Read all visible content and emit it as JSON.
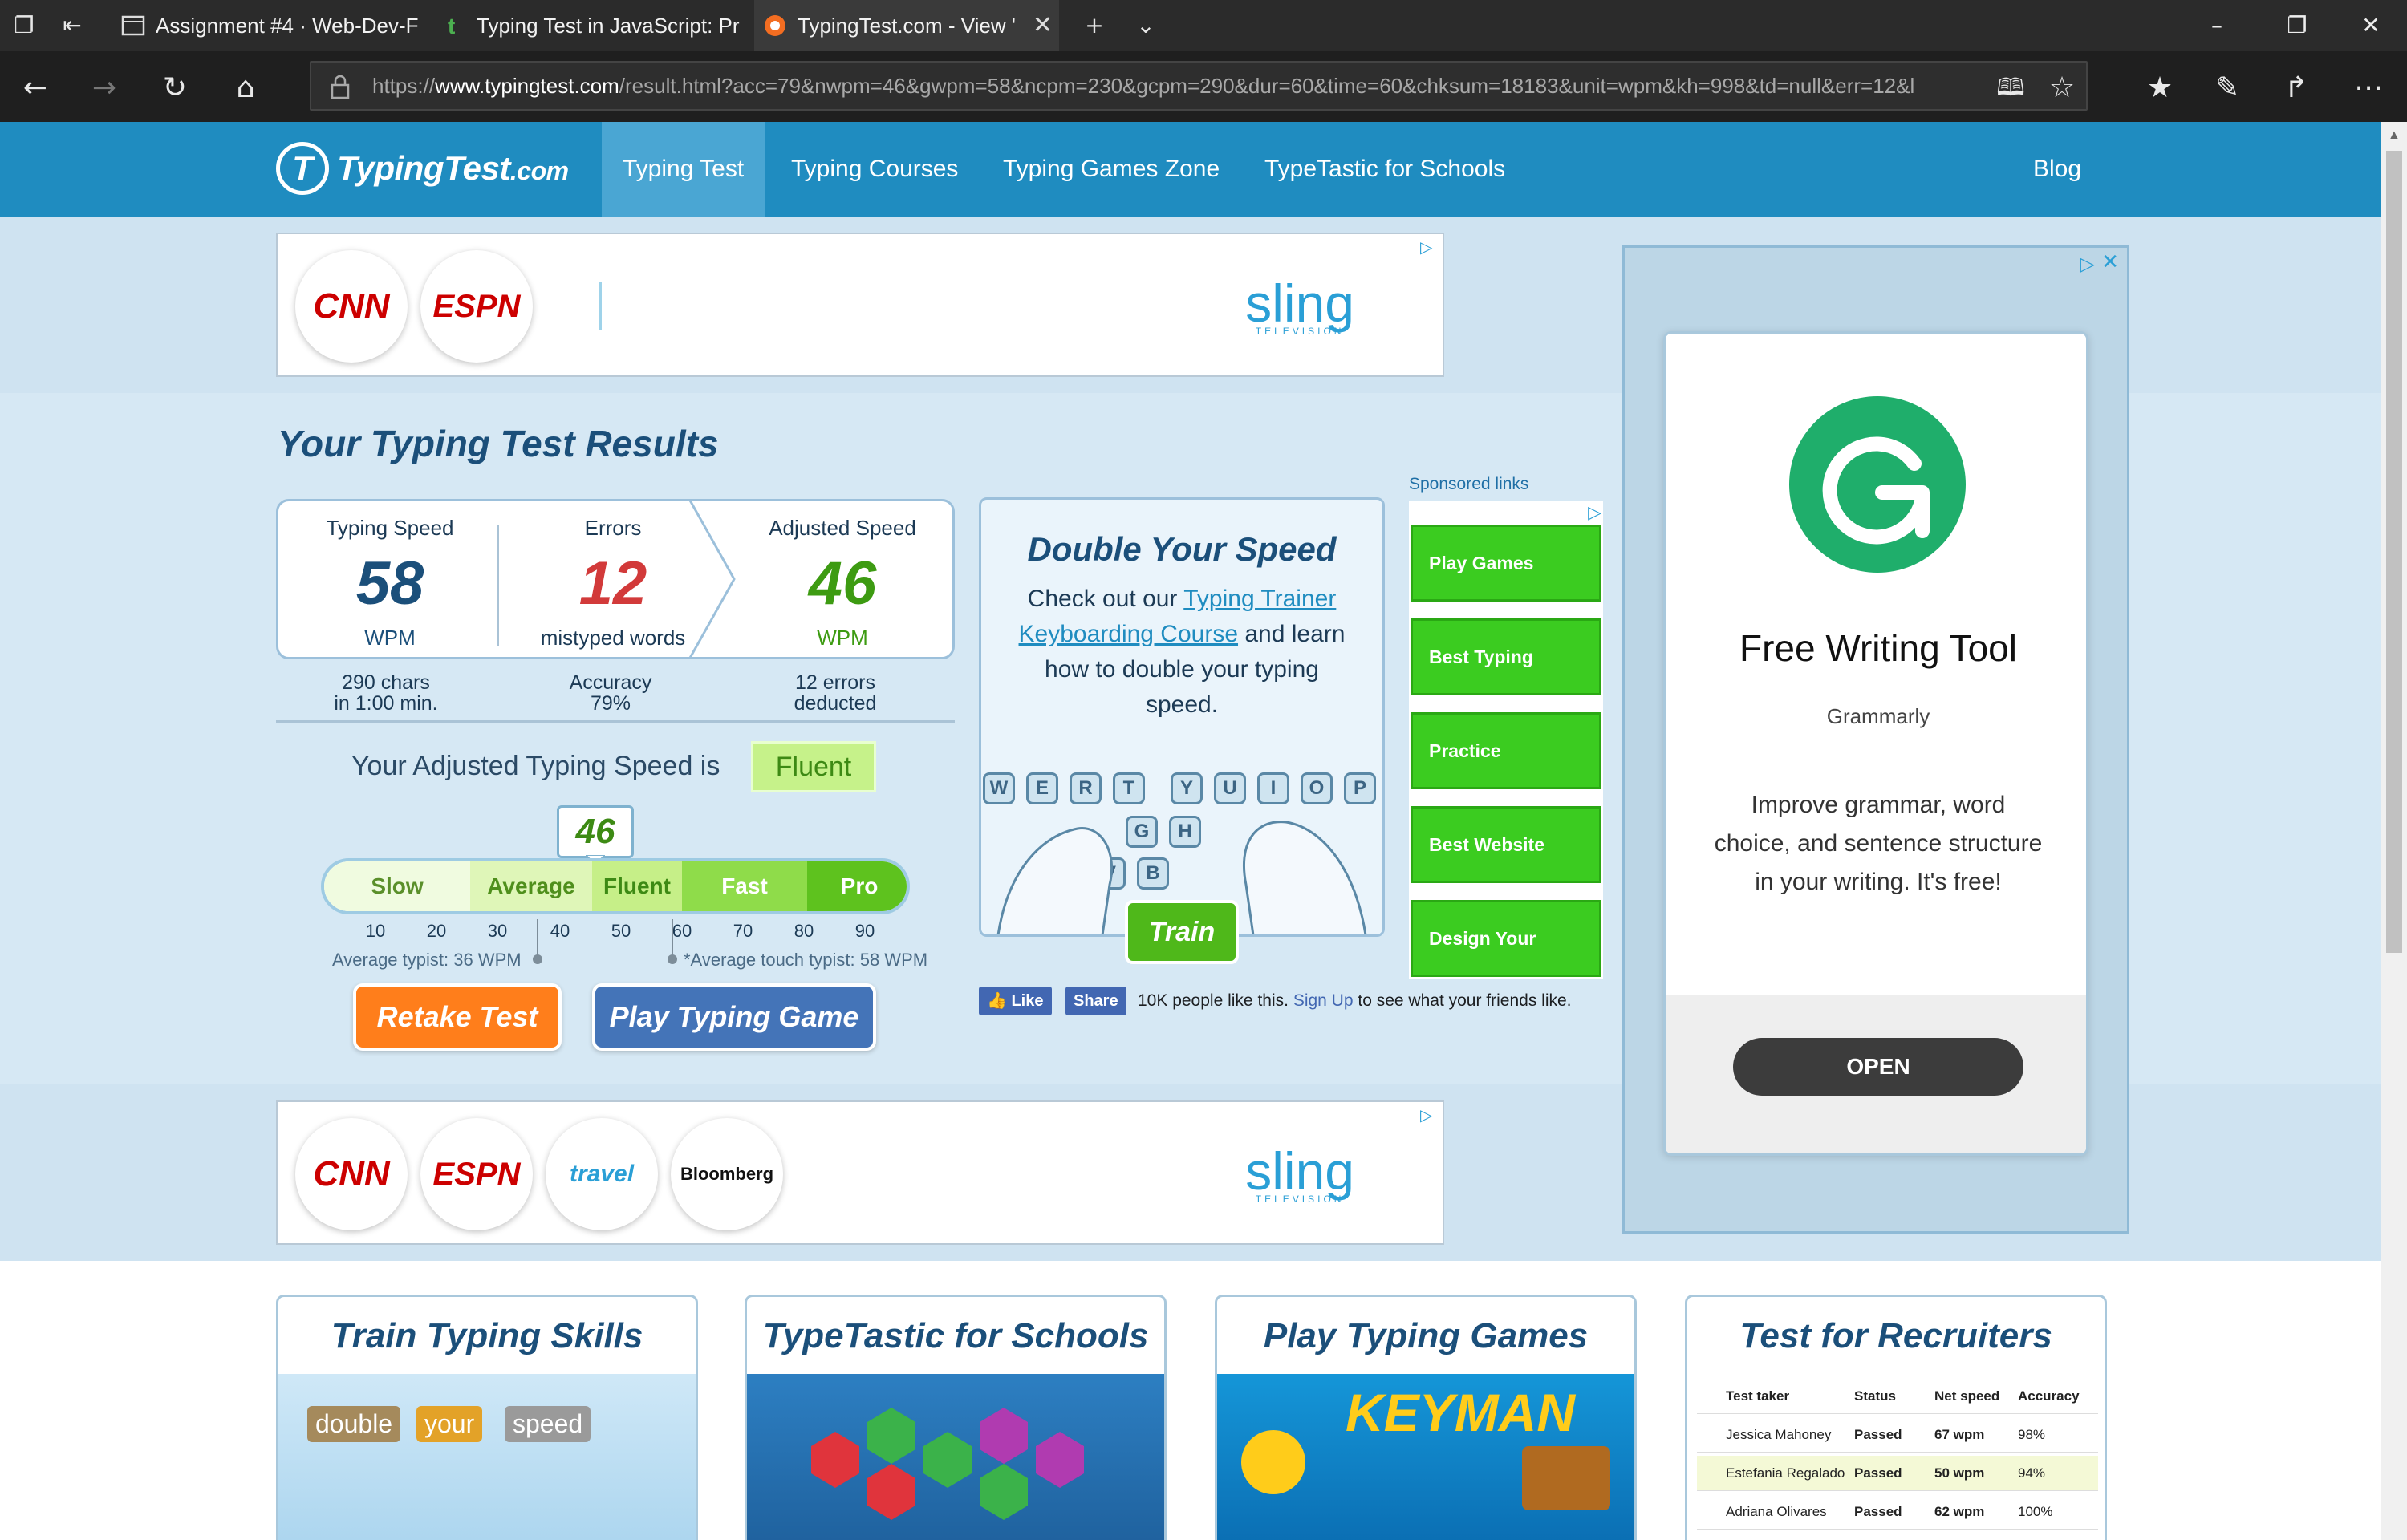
{
  "browser": {
    "tabs": [
      {
        "title": "Assignment #4 · Web-Dev-F"
      },
      {
        "title": "Typing Test in JavaScript: Pr"
      },
      {
        "title": "TypingTest.com - View '"
      }
    ],
    "url_prefix": "https://",
    "url_host": "www.typingtest.com",
    "url_rest": "/result.html?acc=79&nwpm=46&gwpm=58&ncpm=230&gcpm=290&dur=60&time=60&chksum=18183&unit=wpm&kh=998&td=null&err=12&l"
  },
  "site": {
    "logo_main": "TypingTest",
    "logo_tld": ".com",
    "nav": [
      "Typing Test",
      "Typing Courses",
      "Typing Games Zone",
      "TypeTastic for Schools"
    ],
    "blog": "Blog"
  },
  "ads": {
    "top_channels": [
      "CNN",
      "ESPN"
    ],
    "bottom_channels": [
      "CNN",
      "ESPN",
      "travel",
      "Bloomberg"
    ],
    "sling": "sling",
    "sling_sub": "TELEVISION",
    "right": {
      "title": "Free Writing Tool",
      "brand": "Grammarly",
      "desc": "Improve grammar, word choice, and sentence structure in your writing. It's free!",
      "cta": "OPEN"
    }
  },
  "results": {
    "title": "Your Typing Test Results",
    "speed_label": "Typing Speed",
    "speed_value": "58",
    "speed_unit": "WPM",
    "errors_label": "Errors",
    "errors_value": "12",
    "errors_unit": "mistyped words",
    "adjusted_label": "Adjusted Speed",
    "adjusted_value": "46",
    "adjusted_unit": "WPM",
    "sub1_a": "290 chars",
    "sub1_b": "in 1:00 min.",
    "sub2_a": "Accuracy",
    "sub2_b": "79%",
    "sub3_a": "12 errors",
    "sub3_b": "deducted",
    "adjusted_sentence": "Your Adjusted Typing Speed is",
    "level": "Fluent",
    "meter_value": "46",
    "meter_segments": [
      "Slow",
      "Average",
      "Fluent",
      "Fast",
      "Pro"
    ],
    "ticks": [
      "10",
      "20",
      "30",
      "40",
      "50",
      "60",
      "70",
      "80",
      "90"
    ],
    "avg_typist": "Average typist: 36 WPM",
    "avg_touch": "*Average touch typist: 58 WPM",
    "retake": "Retake Test",
    "play_game": "Play Typing Game"
  },
  "promo": {
    "title": "Double Your Speed",
    "text_before": "Check out our",
    "link1": "Typing Trainer",
    "link2": "Keyboarding Course",
    "text_after": "and learn how to double your typing speed.",
    "train": "Train",
    "keys": [
      "W",
      "E",
      "R",
      "T",
      "Y",
      "U",
      "I",
      "O",
      "P",
      "G",
      "H",
      "V",
      "B"
    ]
  },
  "facebook": {
    "like": "Like",
    "share": "Share",
    "text": "10K people like this.",
    "signup": "Sign Up",
    "text2": "to see what your friends like."
  },
  "sponsored": {
    "label": "Sponsored links",
    "links": [
      "Play Games",
      "Best Typing",
      "Practice",
      "Best Website",
      "Design Your"
    ]
  },
  "cards": [
    {
      "title": "Train Typing Skills",
      "words": [
        "double",
        "your",
        "speed"
      ]
    },
    {
      "title": "TypeTastic for Schools"
    },
    {
      "title": "Play Typing Games",
      "game": "KEYMAN"
    },
    {
      "title": "Test for Recruiters"
    }
  ],
  "recruiters": {
    "headers": [
      "Test taker",
      "Status",
      "Net speed",
      "Accuracy"
    ],
    "rows": [
      [
        "Jessica Mahoney",
        "Passed",
        "67 wpm",
        "98%"
      ],
      [
        "Estefania Regalado",
        "Passed",
        "50 wpm",
        "94%"
      ],
      [
        "Adriana Olivares",
        "Passed",
        "62 wpm",
        "100%"
      ]
    ]
  },
  "colors": {
    "header": "#1f8cc0",
    "errors": "#d23a3a",
    "adjusted": "#3d9b12",
    "retake": "#ff7e1b",
    "play": "#4474b8",
    "sponsored_btn": "#3bcc20",
    "grammarly": "#1fae6b"
  }
}
